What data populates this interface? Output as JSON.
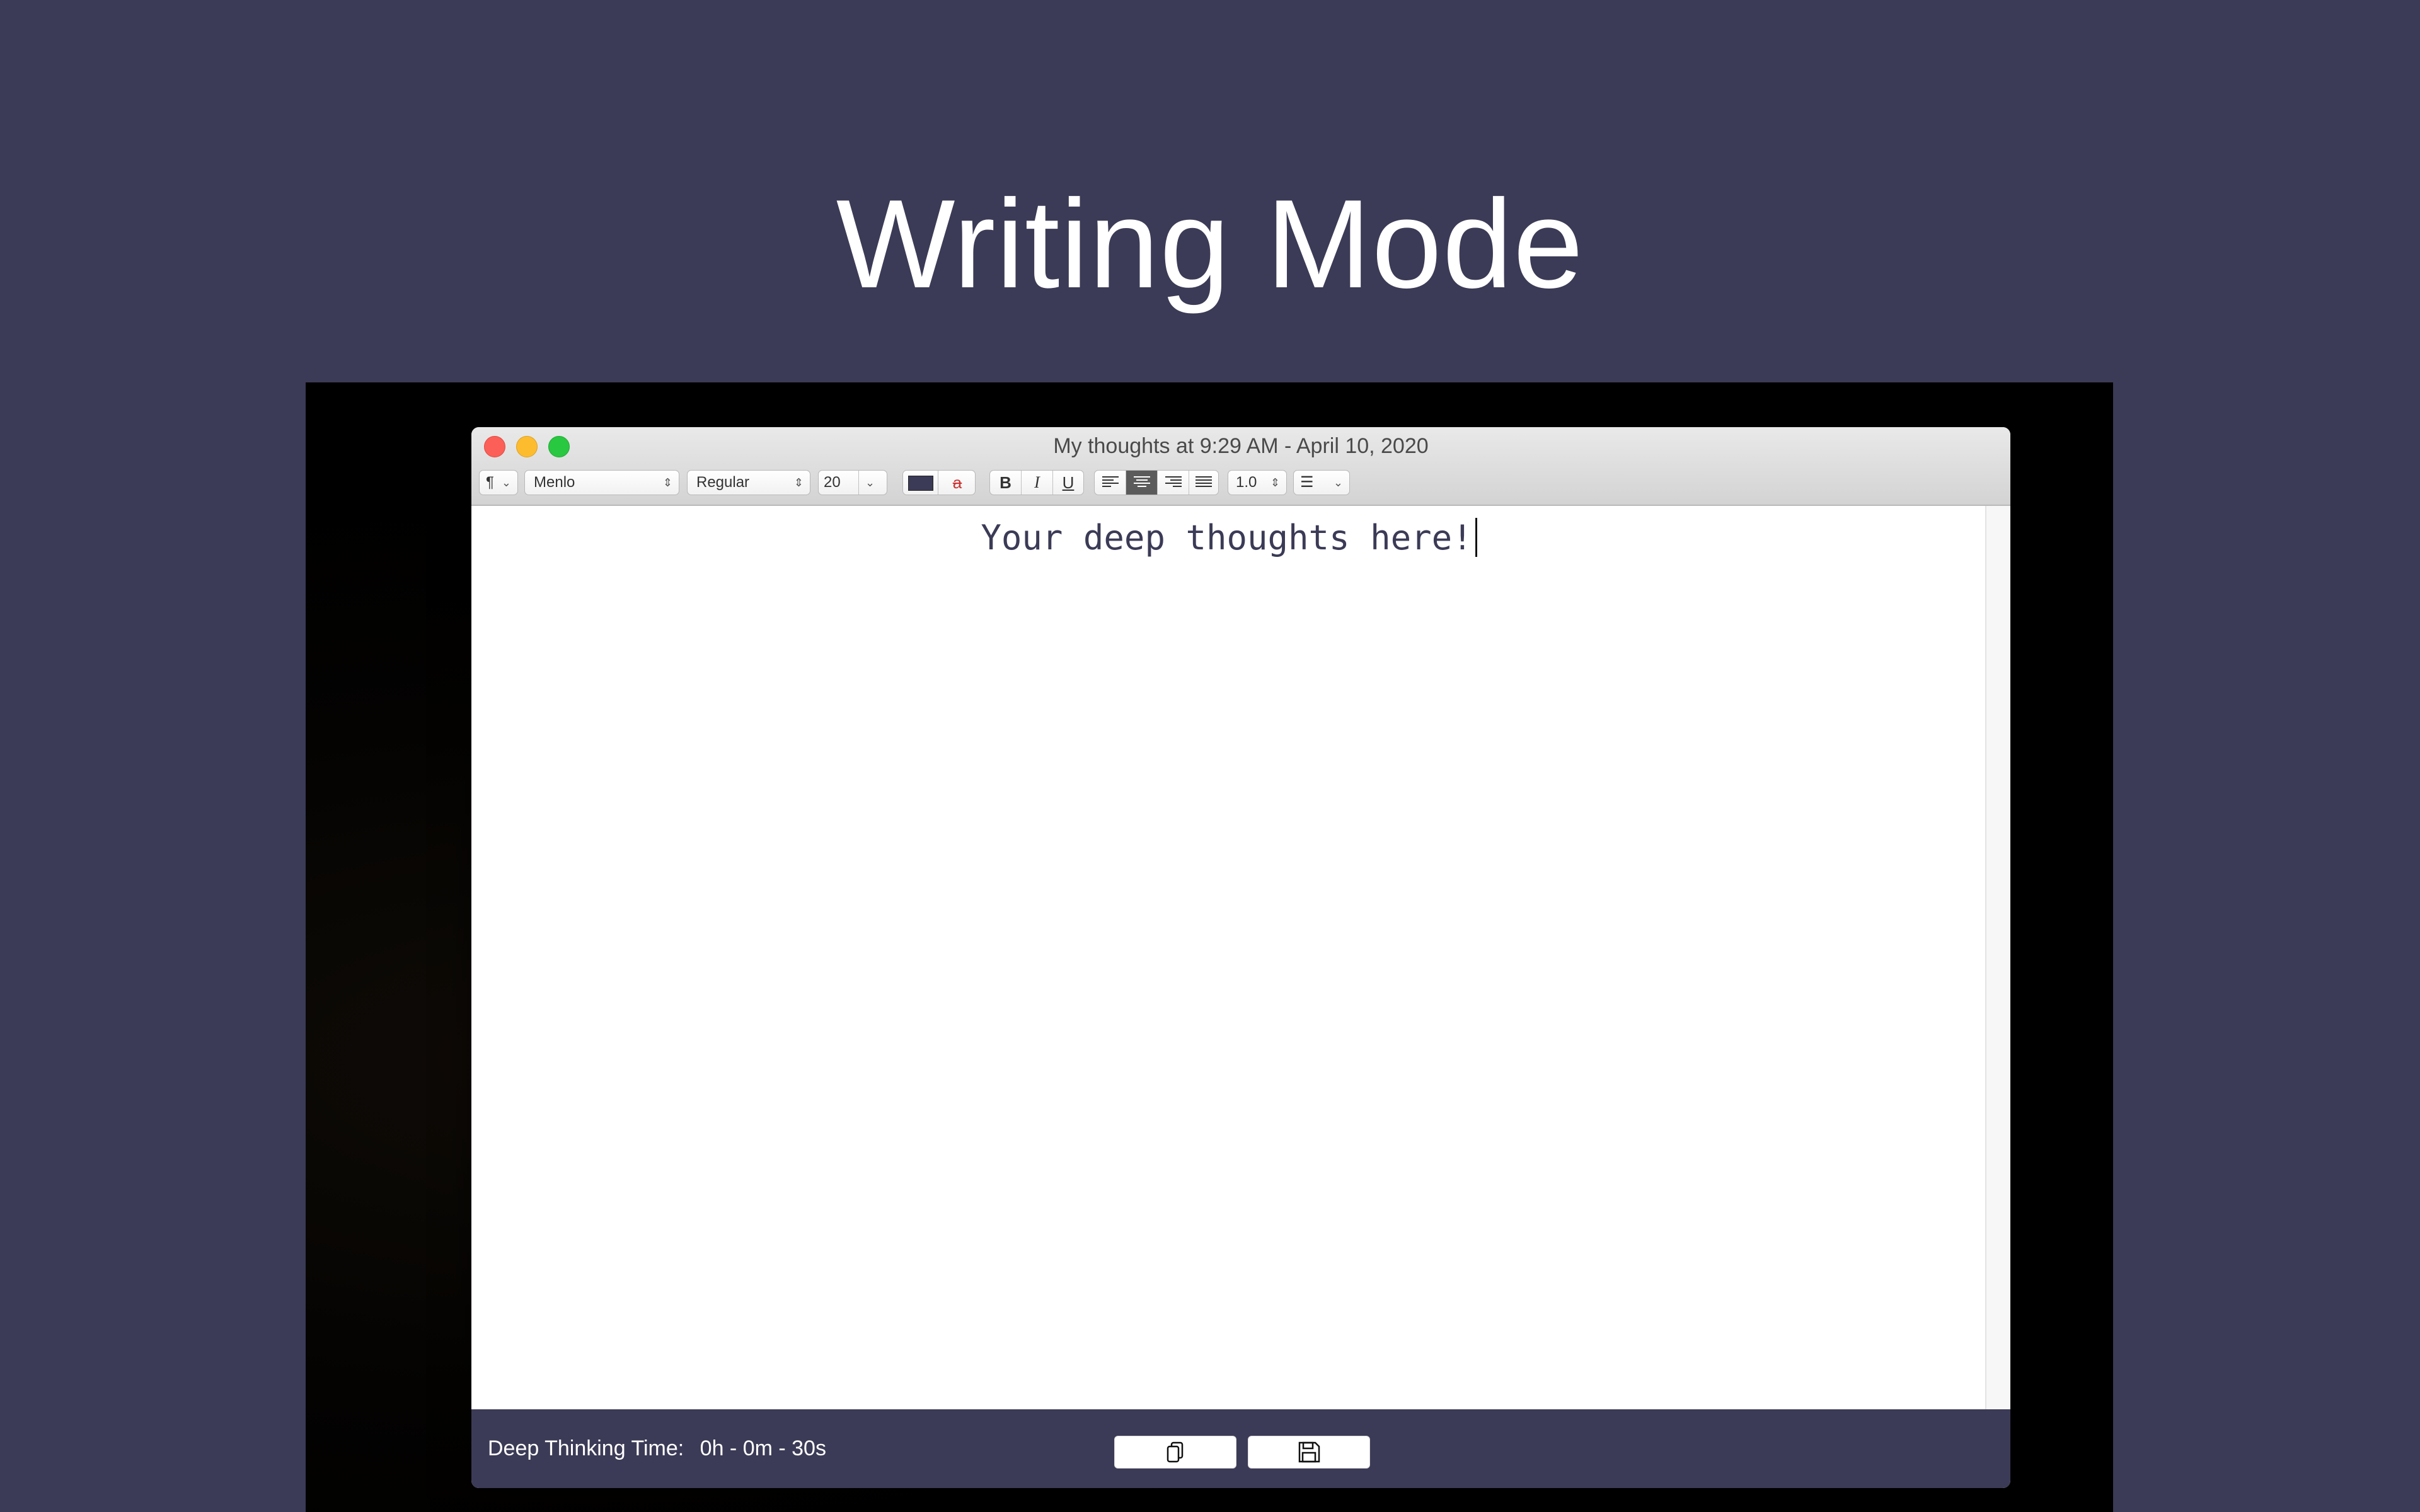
{
  "headline": "Writing Mode",
  "window": {
    "title": "My thoughts at 9:29 AM - April 10, 2020"
  },
  "toolbar": {
    "paragraph_symbol": "¶",
    "font_family": "Menlo",
    "font_style": "Regular",
    "font_size": "20",
    "text_color": "#3b3b57",
    "bold_label": "B",
    "italic_label": "I",
    "underline_label": "U",
    "strike_label": "a",
    "alignment_selected": "center",
    "line_spacing": "1.0",
    "list_icon": "list-bullet-icon"
  },
  "editor": {
    "text": "Your deep thoughts here!"
  },
  "footer": {
    "timer_label": "Deep Thinking Time:",
    "timer_value": "0h - 0m - 30s",
    "copy_icon": "copy-icon",
    "save_icon": "floppy-disk-icon"
  },
  "colors": {
    "background": "#3b3b57",
    "accent": "#3b3b57"
  }
}
